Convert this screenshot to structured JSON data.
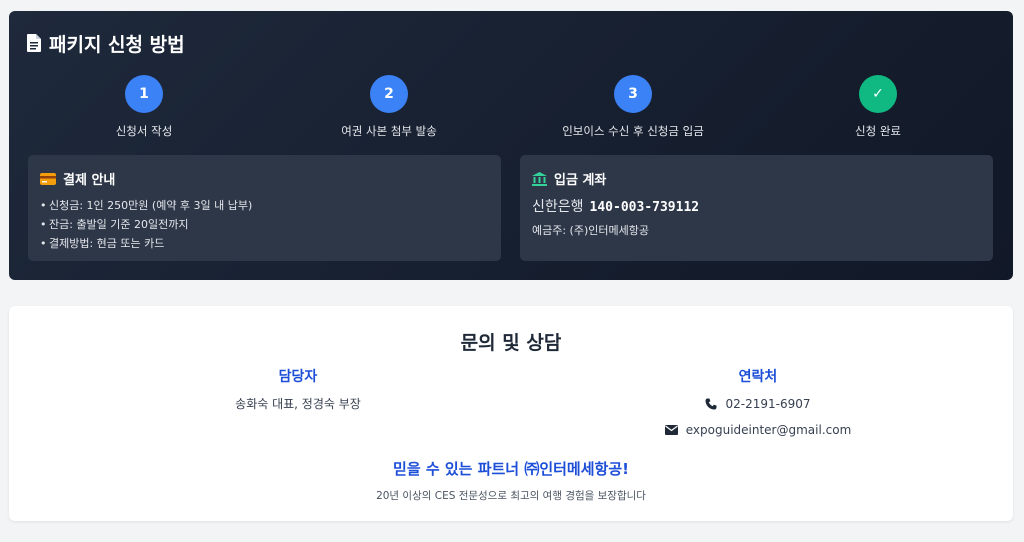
{
  "process": {
    "title": "패키지 신청 방법",
    "steps": [
      {
        "number": "1",
        "label": "신청서 작성"
      },
      {
        "number": "2",
        "label": "여권 사본 첨부 발송"
      },
      {
        "number": "3",
        "label": "인보이스 수신 후 신청금 입금"
      },
      {
        "number": "✓",
        "label": "신청 완료"
      }
    ]
  },
  "payment": {
    "title": "결제 안내",
    "items": [
      "신청금: 1인 250만원 (예약 후 3일 내 납부)",
      "잔금: 출발일 기준 20일전까지",
      "결제방법: 현금 또는 카드"
    ]
  },
  "account": {
    "title": "입금 계좌",
    "bank": "신한은행",
    "number": "140-003-739112",
    "holder": "예금주: (주)인터메세항공"
  },
  "contact": {
    "title": "문의 및 상담",
    "manager_heading": "담당자",
    "managers": "송화숙 대표, 정경숙 부장",
    "contact_heading": "연락처",
    "phone": "02-2191-6907",
    "email": "expoguideinter@gmail.com",
    "slogan": "믿을 수 있는 파트너 ㈜인터메세항공!",
    "subtext": "20년 이상의 CES 전문성으로 최고의 여행 경험을 보장합니다"
  },
  "colors": {
    "step_active": "#3b82f6",
    "step_done": "#10b981",
    "accent_blue": "#1d4ed8",
    "card_icon": "#f59e0b",
    "bank_icon": "#34d399"
  }
}
